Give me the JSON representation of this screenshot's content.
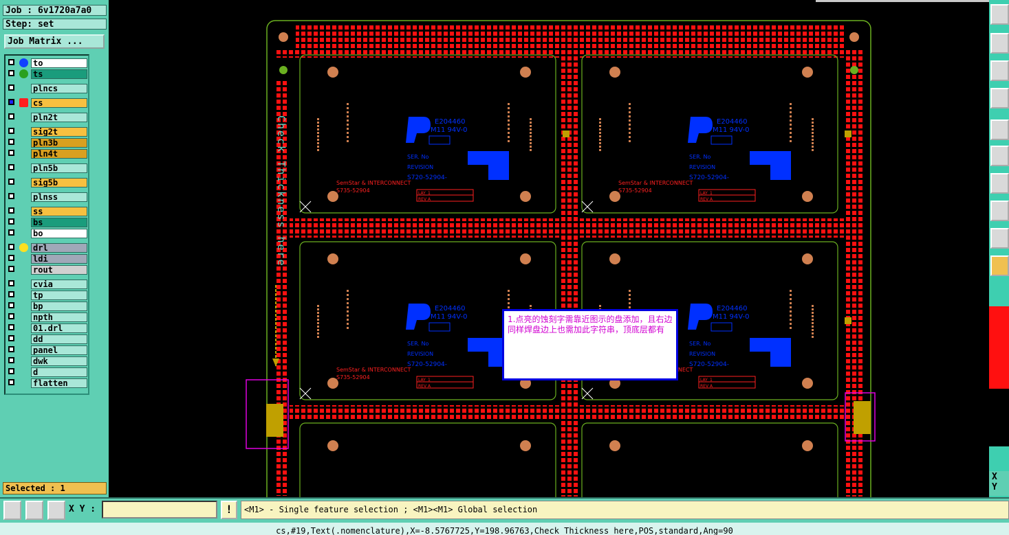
{
  "header": {
    "job": "Job : 6v1720a7a0",
    "step": "Step: set",
    "job_matrix_label": "Job Matrix ..."
  },
  "layers": [
    {
      "name": "to",
      "color": "#ffffff",
      "dot": "#1040ff"
    },
    {
      "name": "ts",
      "color": "#1a9c7c",
      "dot": "#2aa020"
    },
    {
      "name": "plncs",
      "color": "#a9e7d8",
      "dot": ""
    },
    {
      "name": "cs",
      "color": "#f7c040",
      "dot": "",
      "active": true
    },
    {
      "name": "pln2t",
      "color": "#a9e7d8",
      "dot": ""
    },
    {
      "name": "sig2t",
      "color": "#f7c040",
      "dot": ""
    },
    {
      "name": "pln3b",
      "color": "#d9a020",
      "dot": ""
    },
    {
      "name": "pln4t",
      "color": "#d9a020",
      "dot": ""
    },
    {
      "name": "pln5b",
      "color": "#a9e7d8",
      "dot": ""
    },
    {
      "name": "sig5b",
      "color": "#f7c040",
      "dot": ""
    },
    {
      "name": "plnss",
      "color": "#a9e7d8",
      "dot": ""
    },
    {
      "name": "ss",
      "color": "#f7c040",
      "dot": ""
    },
    {
      "name": "bs",
      "color": "#1a9c7c",
      "dot": ""
    },
    {
      "name": "bo",
      "color": "#ffffff",
      "dot": ""
    },
    {
      "name": "drl",
      "color": "#a0a8b8",
      "dot": "#ffe020"
    },
    {
      "name": "ldi",
      "color": "#a0a8b8",
      "dot": ""
    },
    {
      "name": "rout",
      "color": "#d0d0d0",
      "dot": ""
    },
    {
      "name": "cvia",
      "color": "#a9e7d8",
      "dot": ""
    },
    {
      "name": "tp",
      "color": "#a9e7d8",
      "dot": ""
    },
    {
      "name": "bp",
      "color": "#a9e7d8",
      "dot": ""
    },
    {
      "name": "npth",
      "color": "#a9e7d8",
      "dot": ""
    },
    {
      "name": "01.drl",
      "color": "#a9e7d8",
      "dot": ""
    },
    {
      "name": "dd",
      "color": "#a9e7d8",
      "dot": ""
    },
    {
      "name": "panel",
      "color": "#a9e7d8",
      "dot": ""
    },
    {
      "name": "dwk",
      "color": "#a9e7d8",
      "dot": ""
    },
    {
      "name": "d",
      "color": "#a9e7d8",
      "dot": ""
    },
    {
      "name": "flatten",
      "color": "#a9e7d8",
      "dot": ""
    }
  ],
  "selected": "Selected : 1",
  "canvas": {
    "vertical_text": "Check Thickness here",
    "callout_text": "1.点亮的蚀刻字需靠近图示的盘添加，且右边同样焊盘边上也需加此字符串，顶底层都有",
    "board_labels": {
      "ul_code": "E204460",
      "ul_rating": "M11 94V-0",
      "ser_no": "SER. No",
      "revision": "REVISION",
      "part_no": "S720-52904-",
      "company": "SemStar & INTERCONNECT",
      "part_no_2": "S735-52904",
      "lay": "LAY",
      "rev": "REV",
      "lay_val": "1",
      "rev_val": "A"
    },
    "colors": {
      "pad_red": "#ff1010",
      "outline_green": "#6bb020",
      "text_blue": "#0030ff",
      "copper_orange": "#d08050",
      "highlight_magenta": "#e000e0",
      "pad_gold": "#c0a000"
    }
  },
  "bottom": {
    "xy_label": "X Y :",
    "warn_label": "!",
    "prompt": "<M1> - Single feature selection ; <M1><M1> Global selection",
    "status": "cs,#19,Text(.nomenclature),X=-8.5767725,Y=198.96763,Check Thickness here,POS,standard,Ang=90"
  },
  "right_readout": {
    "x_label": "X",
    "y_label": "Y"
  }
}
